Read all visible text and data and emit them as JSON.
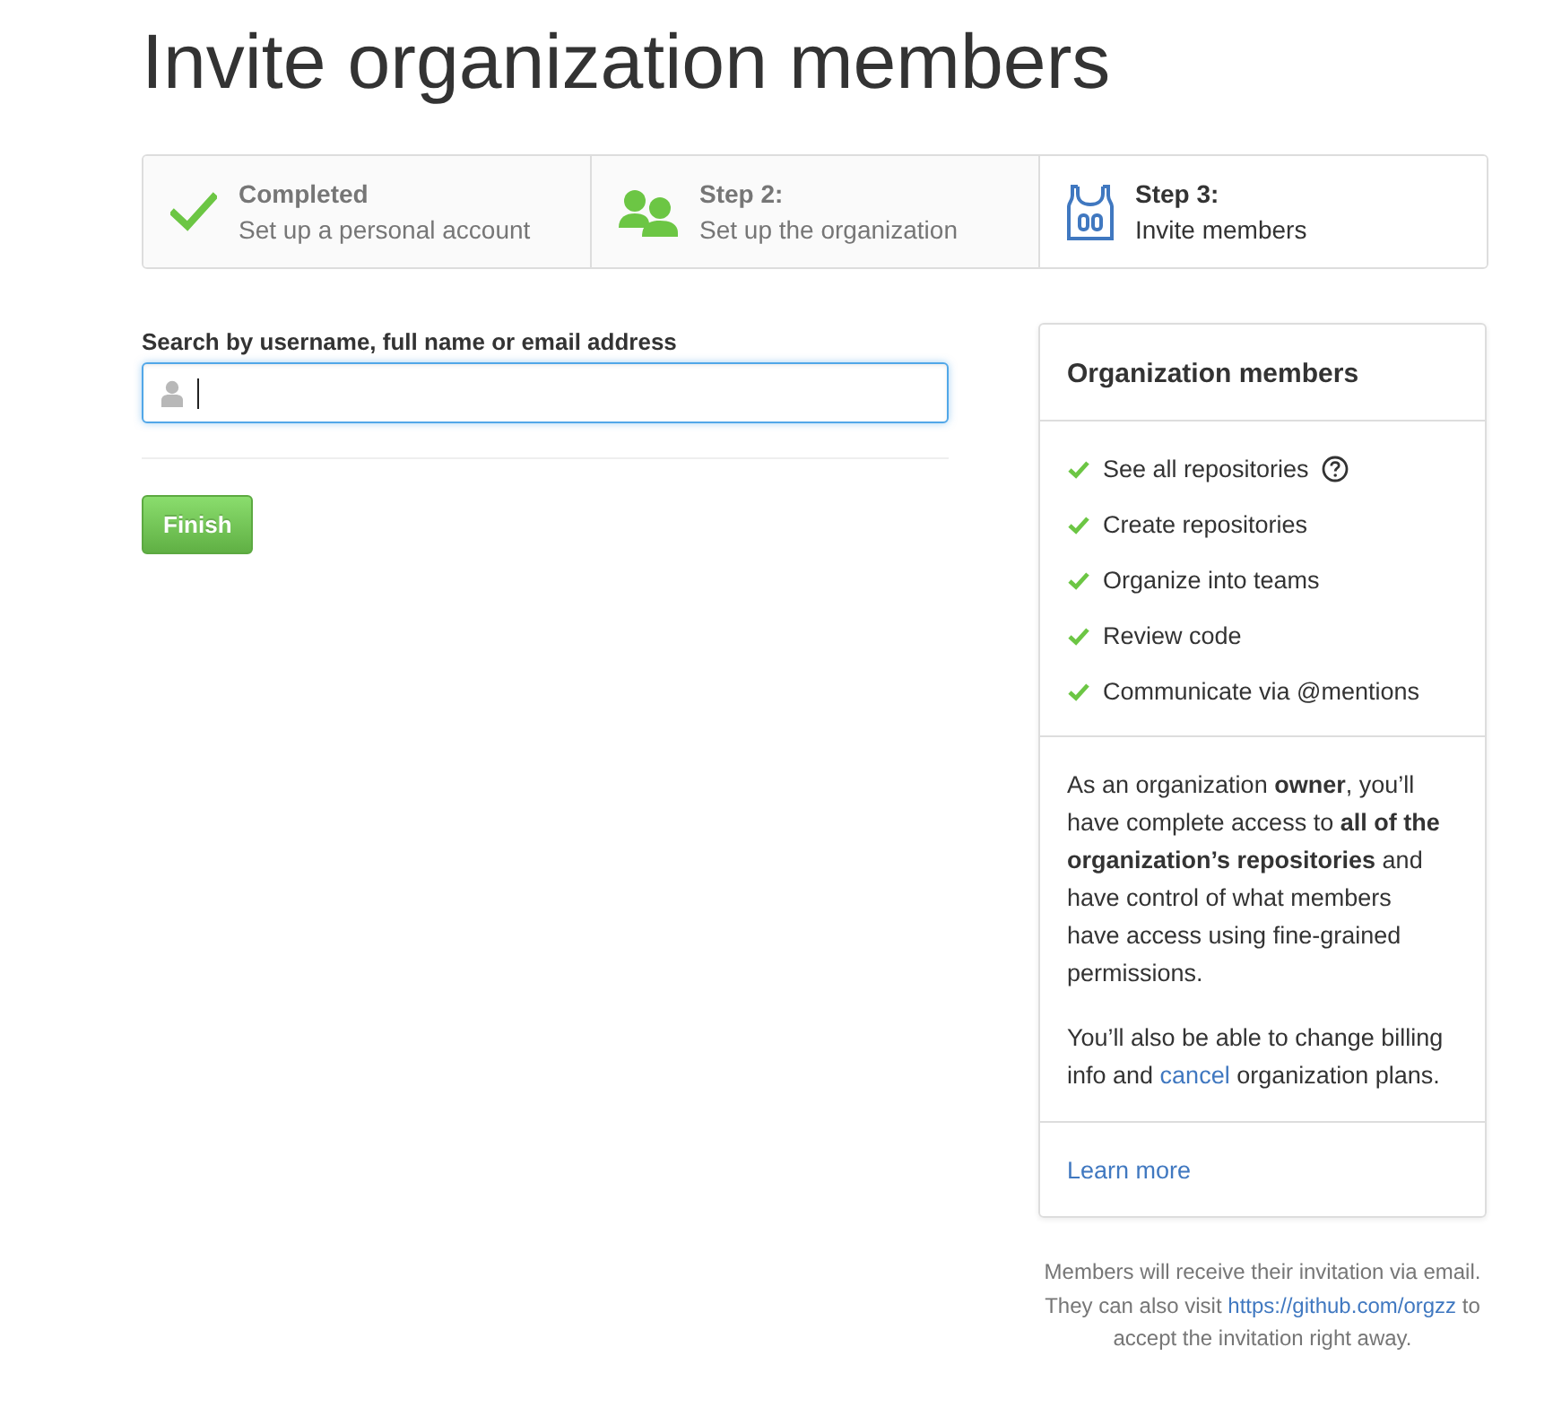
{
  "page": {
    "title": "Invite organization members"
  },
  "steps": [
    {
      "title": "Completed",
      "subtitle": "Set up a personal account",
      "selected": false
    },
    {
      "title": "Step 2:",
      "subtitle": "Set up the organization",
      "selected": false
    },
    {
      "title": "Step 3:",
      "subtitle": "Invite members",
      "selected": true
    }
  ],
  "search": {
    "label": "Search by username, full name or email address",
    "focused": true
  },
  "finish_button": "Finish",
  "panel": {
    "title": "Organization members",
    "permissions": [
      {
        "label": "See all repositories",
        "help": true
      },
      {
        "label": "Create repositories",
        "help": false
      },
      {
        "label": "Organize into teams",
        "help": false
      },
      {
        "label": "Review code",
        "help": false
      },
      {
        "label": "Communicate via @mentions",
        "help": false
      }
    ],
    "description": "As an organization **owner**, you’ll have complete access to **all of the organization’s repositories** and have control of what members have access using fine-grained permissions.",
    "billing": {
      "before": "You’ll also be able to change billing info and ",
      "link": "cancel",
      "after": " organization plans."
    },
    "learn_more": "Learn more"
  },
  "note": {
    "before": "Members will receive their invitation via email. They can also visit ",
    "link": "https://github.com/orgzz",
    "after": " to accept the invitation right away."
  }
}
